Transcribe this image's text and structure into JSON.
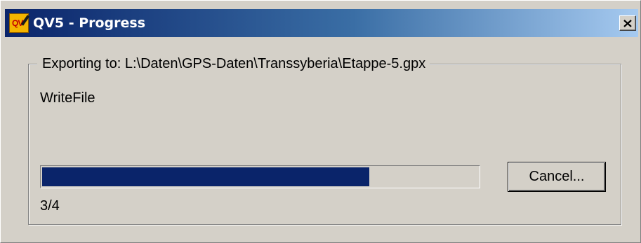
{
  "window": {
    "title": "QV5 - Progress",
    "app_icon": "qv5-app-icon",
    "close_icon": "close-icon"
  },
  "export": {
    "group_label": "Exporting to: L:\\Daten\\GPS-Daten\\Transsyberia\\Etappe-5.gpx",
    "status": "WriteFile",
    "count": "3/4",
    "progress_fraction": 0.75
  },
  "buttons": {
    "cancel_label": "Cancel..."
  },
  "colors": {
    "title_gradient_start": "#0a246a",
    "title_gradient_end": "#a6caf0",
    "progress_fill": "#0a246a",
    "window_face": "#d4d0c8"
  }
}
